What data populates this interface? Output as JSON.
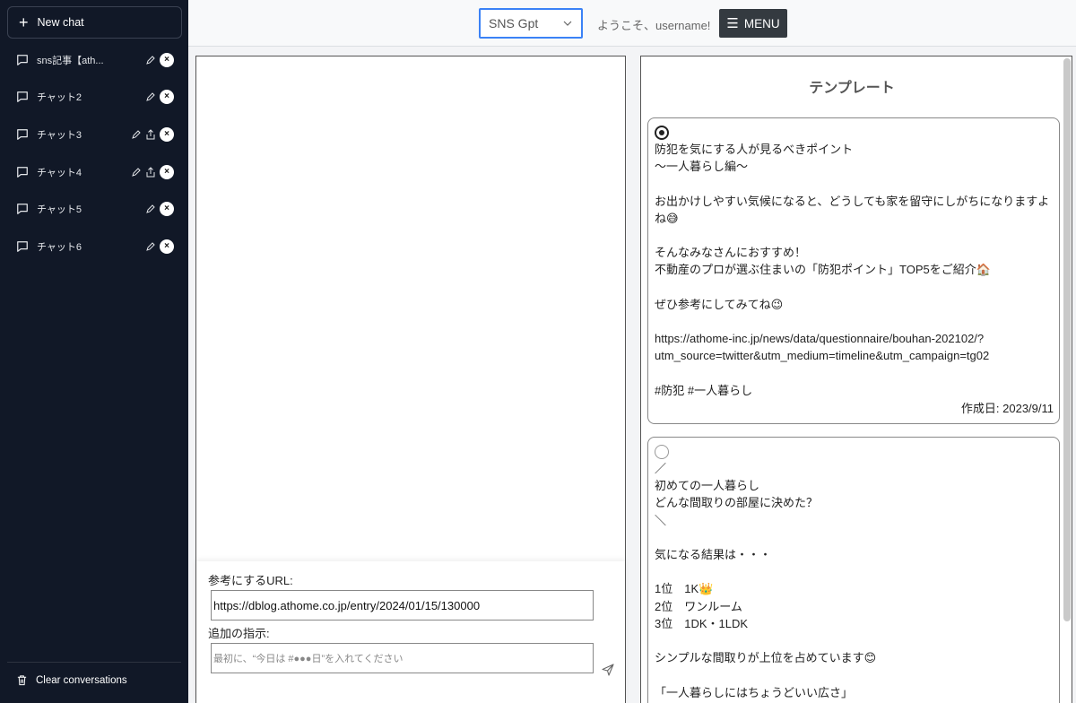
{
  "sidebar": {
    "new_chat_label": "New chat",
    "chats": [
      {
        "label": "sns記事【ath...",
        "share": false
      },
      {
        "label": "チャット2",
        "share": false
      },
      {
        "label": "チャット3",
        "share": true
      },
      {
        "label": "チャット4",
        "share": true
      },
      {
        "label": "チャット5",
        "share": false
      },
      {
        "label": "チャット6",
        "share": false
      }
    ],
    "delete_symbol": "×",
    "clear_label": "Clear conversations"
  },
  "header": {
    "model_value": "SNS Gpt",
    "welcome_text": "ようこそ、username!",
    "menu_label": "MENU"
  },
  "chat_input": {
    "url_label": "参考にするURL:",
    "url_value": "https://dblog.athome.co.jp/entry/2024/01/15/130000",
    "instruction_label": "追加の指示:",
    "instruction_placeholder": "最初に、“今日は #●●●日”を入れてください"
  },
  "templates": {
    "title": "テンプレート",
    "cards": [
      {
        "selected": true,
        "body": "防犯を気にする人が見るべきポイント\n～一人暮らし編～\n\nお出かけしやすい気候になると、どうしても家を留守にしがちになりますよね😅\n\nそんなみなさんにおすすめ！\n不動産のプロが選ぶ住まいの「防犯ポイント」TOP5をご紹介🏠\n\nぜひ参考にしてみてね😉\n\nhttps://athome-inc.jp/news/data/questionnaire/bouhan-202102/?utm_source=twitter&utm_medium=timeline&utm_campaign=tg02\n\n#防犯 #一人暮らし",
        "date": "作成日: 2023/9/11"
      },
      {
        "selected": false,
        "body": "／\n初めての一人暮らし\nどんな間取りの部屋に決めた？\n＼\n\n気になる結果は・・・\n\n1位　1K👑\n2位　ワンルーム\n3位　1DK・1LDK\n\nシンプルな間取りが上位を占めています😊\n\n「一人暮らしにはちょうどいい広さ」",
        "date": ""
      }
    ]
  }
}
